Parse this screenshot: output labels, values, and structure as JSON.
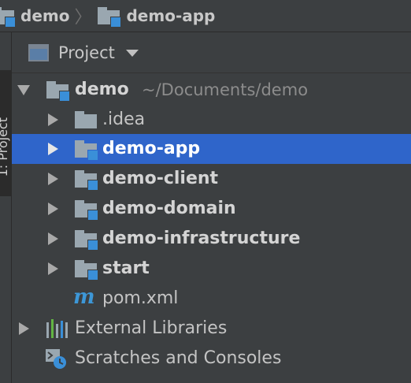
{
  "breadcrumb": {
    "items": [
      {
        "label": "demo"
      },
      {
        "label": "demo-app"
      }
    ],
    "separator": "〉"
  },
  "left_strip": {
    "label": "1: Project"
  },
  "panel": {
    "title": "Project"
  },
  "tree": {
    "root": {
      "label": "demo",
      "path": "~/Documents/demo"
    },
    "children": [
      {
        "label": ".idea"
      },
      {
        "label": "demo-app",
        "selected": true
      },
      {
        "label": "demo-client"
      },
      {
        "label": "demo-domain"
      },
      {
        "label": "demo-infrastructure"
      },
      {
        "label": "start"
      },
      {
        "label": "pom.xml"
      }
    ],
    "external_libraries": {
      "label": "External Libraries"
    },
    "scratches": {
      "label": "Scratches and Consoles"
    }
  },
  "colors": {
    "background": "#3c3f41",
    "selection": "#2f65ca",
    "module_badge": "#3a8fd8",
    "maven_icon": "#3d97d7"
  }
}
